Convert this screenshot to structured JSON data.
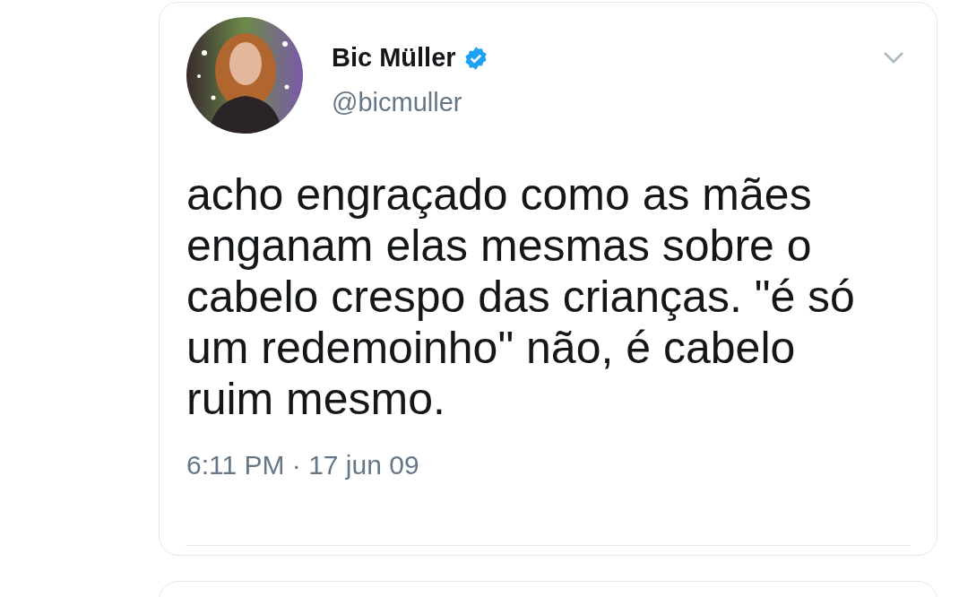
{
  "tweet": {
    "name": "Bic Müller",
    "verified": true,
    "handle": "@bicmuller",
    "text": "acho engraçado como as mães enganam elas mesmas sobre o cabelo crespo das crianças. \"é só um redemoinho\" não, é cabelo ruim mesmo.",
    "timestamp": "6:11 PM · 17 jun 09"
  }
}
